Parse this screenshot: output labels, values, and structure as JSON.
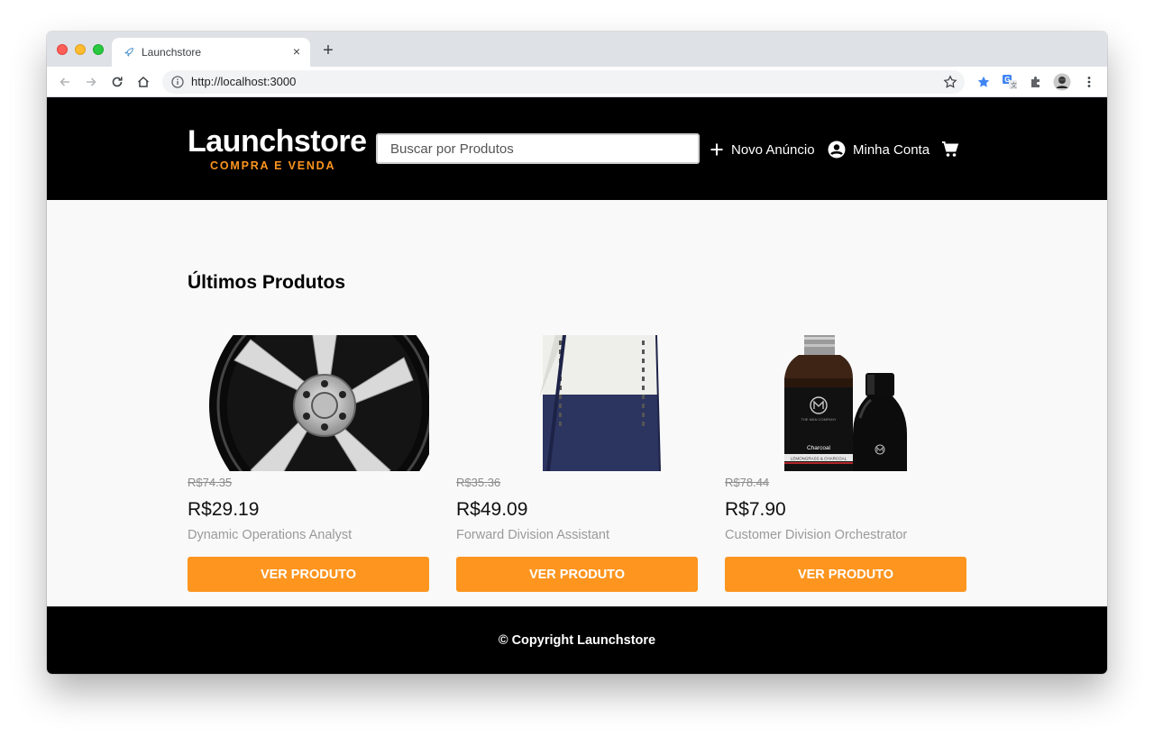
{
  "browser": {
    "tab_title": "Launchstore",
    "tab_close": "×",
    "new_tab": "+",
    "url": "http://localhost:3000"
  },
  "header": {
    "logo_title": "Launchstore",
    "logo_subtitle": "COMPRA E VENDA",
    "search_placeholder": "Buscar por Produtos",
    "new_ad_label": "Novo Anúncio",
    "account_label": "Minha Conta"
  },
  "main": {
    "section_title": "Últimos Produtos",
    "products": [
      {
        "old_price": "R$74.35",
        "price": "R$29.19",
        "name": "Dynamic Operations Analyst",
        "button_label": "VER PRODUTO",
        "image": "wheel-rim"
      },
      {
        "old_price": "R$35.36",
        "price": "R$49.09",
        "name": "Forward Division Assistant",
        "button_label": "VER PRODUTO",
        "image": "sweater"
      },
      {
        "old_price": "R$78.44",
        "price": "R$7.90",
        "name": "Customer Division Orchestrator",
        "button_label": "VER PRODUTO",
        "image": "charcoal-bottles",
        "image_text": {
          "brand": "THE MAN COMPANY",
          "label": "Charcoal",
          "sublabel": "LEMONGRASS & CHARCOAL"
        }
      }
    ]
  },
  "footer": {
    "copyright": "© Copyright Launchstore"
  },
  "colors": {
    "accent": "#fd951f",
    "header_bg": "#000000",
    "page_bg": "#f9f9f9"
  }
}
